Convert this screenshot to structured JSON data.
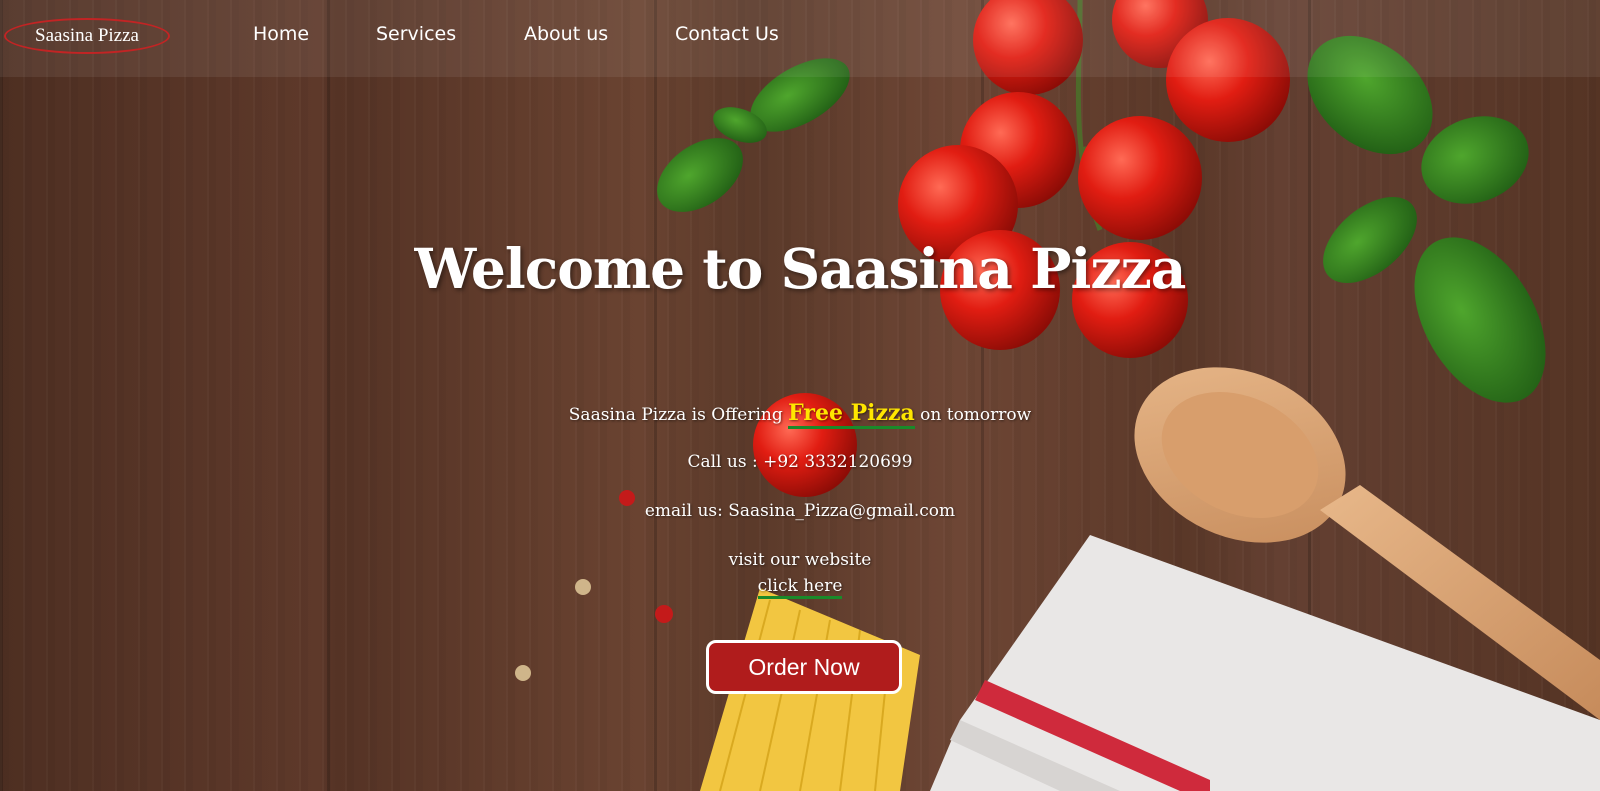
{
  "nav": {
    "logo": "Saasina Pizza",
    "items": [
      "Home",
      "Services",
      "About us",
      "Contact Us"
    ]
  },
  "hero": {
    "title": "Welcome to Saasina Pizza",
    "offer_prefix": "Saasina Pizza is Offering ",
    "offer_highlight": "Free Pizza",
    "offer_suffix": " on tomorrow",
    "phone": "Call us : +92 3332120699",
    "email": "email us: Saasina_Pizza@gmail.com",
    "visit": "visit our website",
    "link": "click here",
    "order_button": "Order Now"
  },
  "colors": {
    "accent_red": "#b01c1c",
    "highlight_yellow": "#ffe600",
    "underline_green": "#1a8a2a"
  }
}
